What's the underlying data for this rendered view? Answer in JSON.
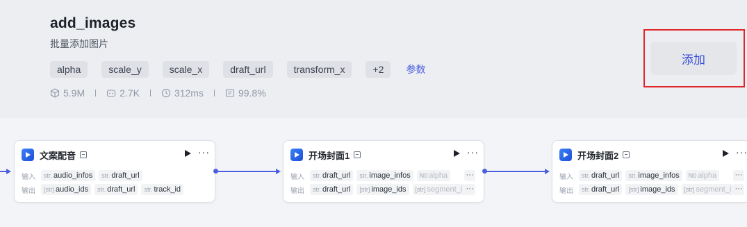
{
  "plugin": {
    "name": "add_images",
    "description": "批量添加图片",
    "tags": [
      "alpha",
      "scale_y",
      "scale_x",
      "draft_url",
      "transform_x"
    ],
    "more_tags": "+2",
    "params_link": "参数",
    "stats": {
      "downloads": "5.9M",
      "bots": "2.7K",
      "latency": "312ms",
      "success_rate": "99.8%"
    },
    "add_label": "添加"
  },
  "workflow": {
    "nodes": [
      {
        "title": "文案配音",
        "input_label": "输入",
        "output_label": "输出",
        "inputs": [
          {
            "type": "str.",
            "name": "audio_infos"
          },
          {
            "type": "str.",
            "name": "draft_url"
          }
        ],
        "outputs": [
          {
            "type": "[str]",
            "name": "audio_ids"
          },
          {
            "type": "str.",
            "name": "draft_url"
          },
          {
            "type": "str.",
            "name": "track_id"
          }
        ]
      },
      {
        "title": "开场封面1",
        "input_label": "输入",
        "output_label": "输出",
        "inputs": [
          {
            "type": "str.",
            "name": "draft_url"
          },
          {
            "type": "str.",
            "name": "image_infos"
          },
          {
            "type": "N0",
            "name": "alpha"
          }
        ],
        "outputs": [
          {
            "type": "str.",
            "name": "draft_url"
          },
          {
            "type": "[str]",
            "name": "image_ids"
          },
          {
            "type": "[str]",
            "name": "segment_i"
          }
        ]
      },
      {
        "title": "开场封面2",
        "input_label": "输入",
        "output_label": "输出",
        "inputs": [
          {
            "type": "str.",
            "name": "draft_url"
          },
          {
            "type": "str.",
            "name": "image_infos"
          },
          {
            "type": "N0",
            "name": "alpha"
          }
        ],
        "outputs": [
          {
            "type": "str.",
            "name": "draft_url"
          },
          {
            "type": "[str]",
            "name": "image_ids"
          },
          {
            "type": "[str]",
            "name": "segment_i"
          }
        ]
      }
    ],
    "more_glyph": "···"
  },
  "colors": {
    "accent": "#4c5fe0",
    "highlight": "#e0262b"
  }
}
